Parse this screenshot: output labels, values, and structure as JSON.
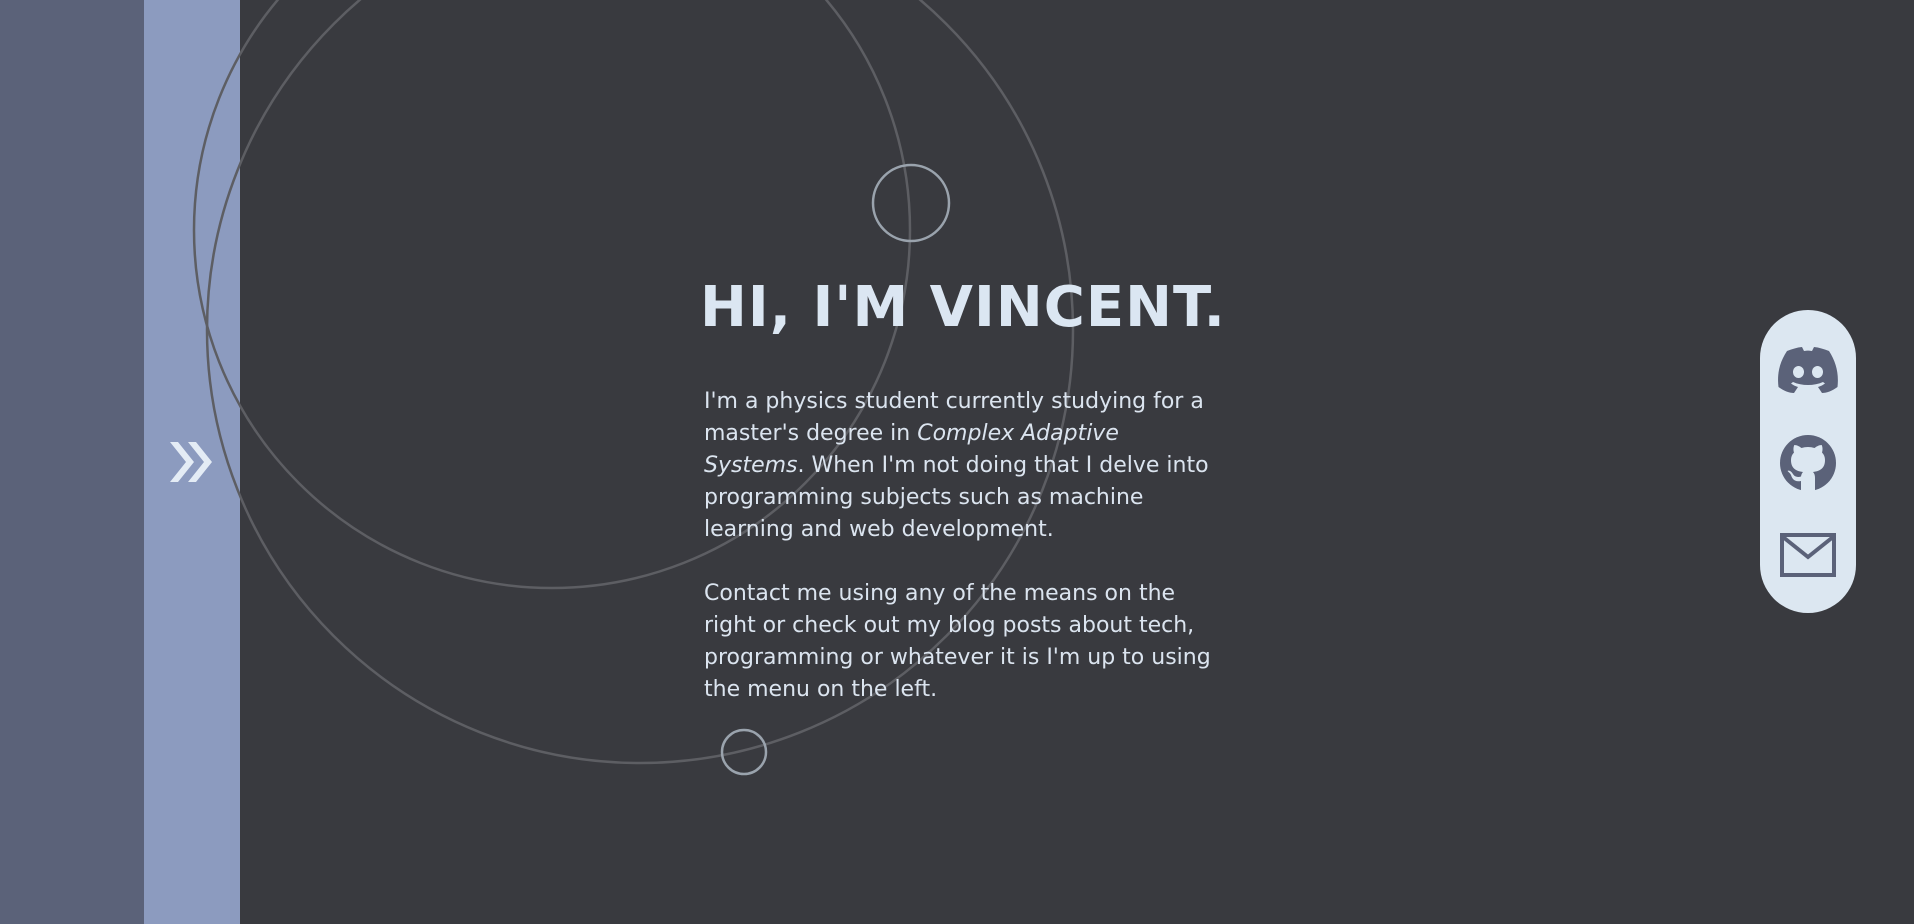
{
  "hero": {
    "title": "HI, I'M VINCENT.",
    "intro_part1": "I'm a physics student currently studying for a master's degree in ",
    "intro_emphasis": "Complex Adaptive Systems",
    "intro_part2": ". When I'm not doing that I delve into programming subjects such as machine learning and web development.",
    "contact": "Contact me using any of the means on the right or check out my blog posts about tech, programming or whatever it is I'm up to using the menu on the left."
  },
  "menu": {
    "icon": "double-chevron-right-icon"
  },
  "social": {
    "links": [
      {
        "name": "discord",
        "icon": "discord-icon"
      },
      {
        "name": "github",
        "icon": "github-icon"
      },
      {
        "name": "email",
        "icon": "mail-icon"
      }
    ]
  },
  "colors": {
    "background": "#393a3f",
    "left_rail": "#5b6279",
    "menu_strip": "#8c9bbf",
    "text": "#dbe4ef",
    "social_panel": "#dce7f1",
    "social_icon": "#5b6279"
  }
}
